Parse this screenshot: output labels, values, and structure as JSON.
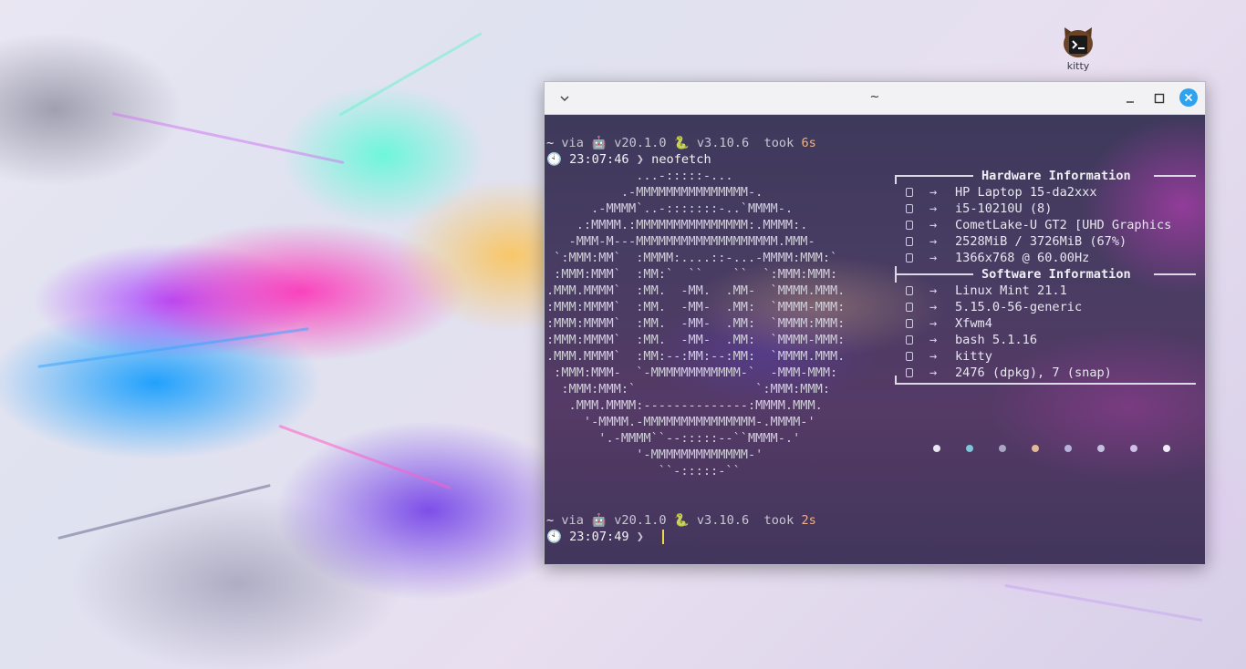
{
  "desktop": {
    "icon_label": "kitty"
  },
  "window": {
    "title": "~"
  },
  "terminal": {
    "prompt1": {
      "tilde": "~",
      "via": "via",
      "node_version": "v20.1.0",
      "python_version": "v3.10.6",
      "took": "took",
      "duration": "6s",
      "time": "23:07:46",
      "arrow": "❯",
      "command": "neofetch"
    },
    "prompt2": {
      "tilde": "~",
      "via": "via",
      "node_version": "v20.1.0",
      "python_version": "v3.10.6",
      "took": "took",
      "duration": "2s",
      "time": "23:07:49",
      "arrow": "❯"
    },
    "ascii_art": [
      "            ...-:::::-...",
      "          .-MMMMMMMMMMMMMMM-.",
      "      .-MMMM`..-:::::::-..`MMMM-.",
      "    .:MMMM.:MMMMMMMMMMMMMMM:.MMMM:.",
      "   -MMM-M---MMMMMMMMMMMMMMMMMMM.MMM-",
      " `:MMM:MM`  :MMMM:....::-...-MMMM:MMM:`",
      " :MMM:MMM`  :MM:`  ``    ``  `:MMM:MMM:",
      ".MMM.MMMM`  :MM.  -MM.  .MM-  `MMMM.MMM.",
      ":MMM:MMMM`  :MM.  -MM-  .MM:  `MMMM-MMM:",
      ":MMM:MMMM`  :MM.  -MM-  .MM:  `MMMM:MMM:",
      ":MMM:MMMM`  :MM.  -MM-  .MM:  `MMMM-MMM:",
      ".MMM.MMMM`  :MM:--:MM:--:MM:  `MMMM.MMM.",
      " :MMM:MMM-  `-MMMMMMMMMMMM-`  -MMM-MMM:",
      "  :MMM:MMM:`                `:MMM:MMM:",
      "   .MMM.MMMM:--------------:MMMM.MMM.",
      "     '-MMMM.-MMMMMMMMMMMMMMM-.MMMM-'",
      "       '.-MMMM``--:::::--``MMMM-.'",
      "            '-MMMMMMMMMMMMM-'",
      "               ``-:::::-``"
    ],
    "hardware_header": "Hardware Information",
    "software_header": "Software Information",
    "arrow": "→",
    "hardware": [
      {
        "icon": "laptop-icon",
        "value": "HP Laptop 15-da2xxx"
      },
      {
        "icon": "cpu-icon",
        "value": "i5-10210U (8)"
      },
      {
        "icon": "gpu-icon",
        "value": "CometLake-U GT2 [UHD Graphics"
      },
      {
        "icon": "memory-icon",
        "value": "2528MiB / 3726MiB (67%)"
      },
      {
        "icon": "display-icon",
        "value": "1366x768 @ 60.00Hz"
      }
    ],
    "software": [
      {
        "icon": "distro-icon",
        "value": "Linux Mint 21.1"
      },
      {
        "icon": "kernel-icon",
        "value": "5.15.0-56-generic"
      },
      {
        "icon": "wm-icon",
        "value": "Xfwm4"
      },
      {
        "icon": "shell-icon",
        "value": "bash 5.1.16"
      },
      {
        "icon": "terminal-icon",
        "value": "kitty"
      },
      {
        "icon": "packages-icon",
        "value": "2476 (dpkg), 7 (snap)"
      }
    ],
    "palette_dots": [
      "#e8e6f0",
      "#7fc6d8",
      "#a8a6c4",
      "#e2b896",
      "#b7b2dc",
      "#c4c0e0",
      "#cdbfe6",
      "#eeeaf6"
    ]
  }
}
